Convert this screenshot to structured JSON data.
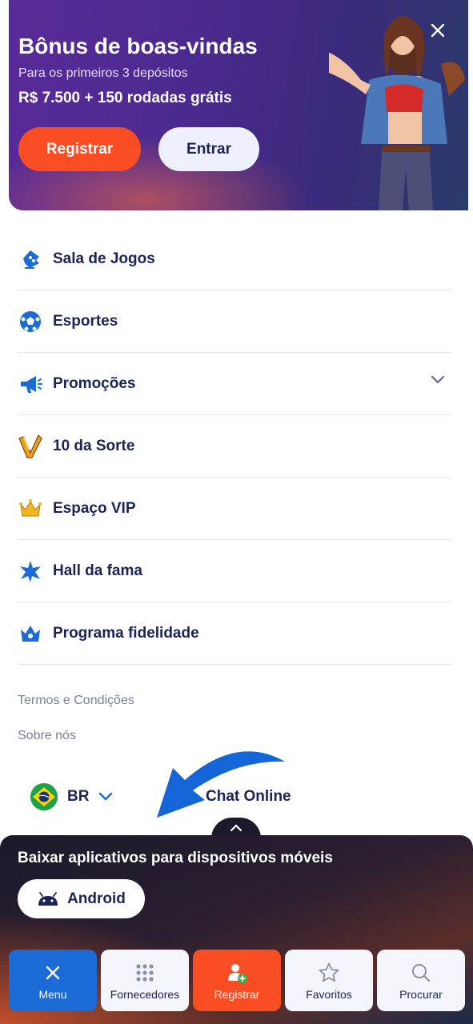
{
  "banner": {
    "title": "Bônus de boas-vindas",
    "subtitle": "Para os primeiros 3 depósitos",
    "offer": "R$ 7.500 + 150 rodadas grátis",
    "register_label": "Registrar",
    "login_label": "Entrar"
  },
  "menu": {
    "items": [
      {
        "label": "Sala de Jogos",
        "icon": "game-room-icon"
      },
      {
        "label": "Esportes",
        "icon": "soccer-ball-icon"
      },
      {
        "label": "Promoções",
        "icon": "megaphone-icon"
      },
      {
        "label": "10 da Sorte",
        "icon": "lucky-v-icon"
      },
      {
        "label": "Espaço VIP",
        "icon": "crown-gold-icon"
      },
      {
        "label": "Hall da fama",
        "icon": "star-burst-icon"
      },
      {
        "label": "Programa fidelidade",
        "icon": "crown-blue-icon"
      }
    ]
  },
  "links": {
    "terms": "Termos e Condições",
    "about": "Sobre nós"
  },
  "language": {
    "code": "BR"
  },
  "chat": {
    "label": "Chat Online"
  },
  "app_panel": {
    "title": "Baixar aplicativos para dispositivos móveis",
    "android_label": "Android"
  },
  "bottom_nav": {
    "menu": "Menu",
    "providers": "Fornecedores",
    "register": "Registrar",
    "favorites": "Favoritos",
    "search": "Procurar"
  },
  "colors": {
    "brand_blue": "#1a6bd6",
    "brand_orange": "#fb4d24",
    "text_dark": "#1b2357"
  }
}
